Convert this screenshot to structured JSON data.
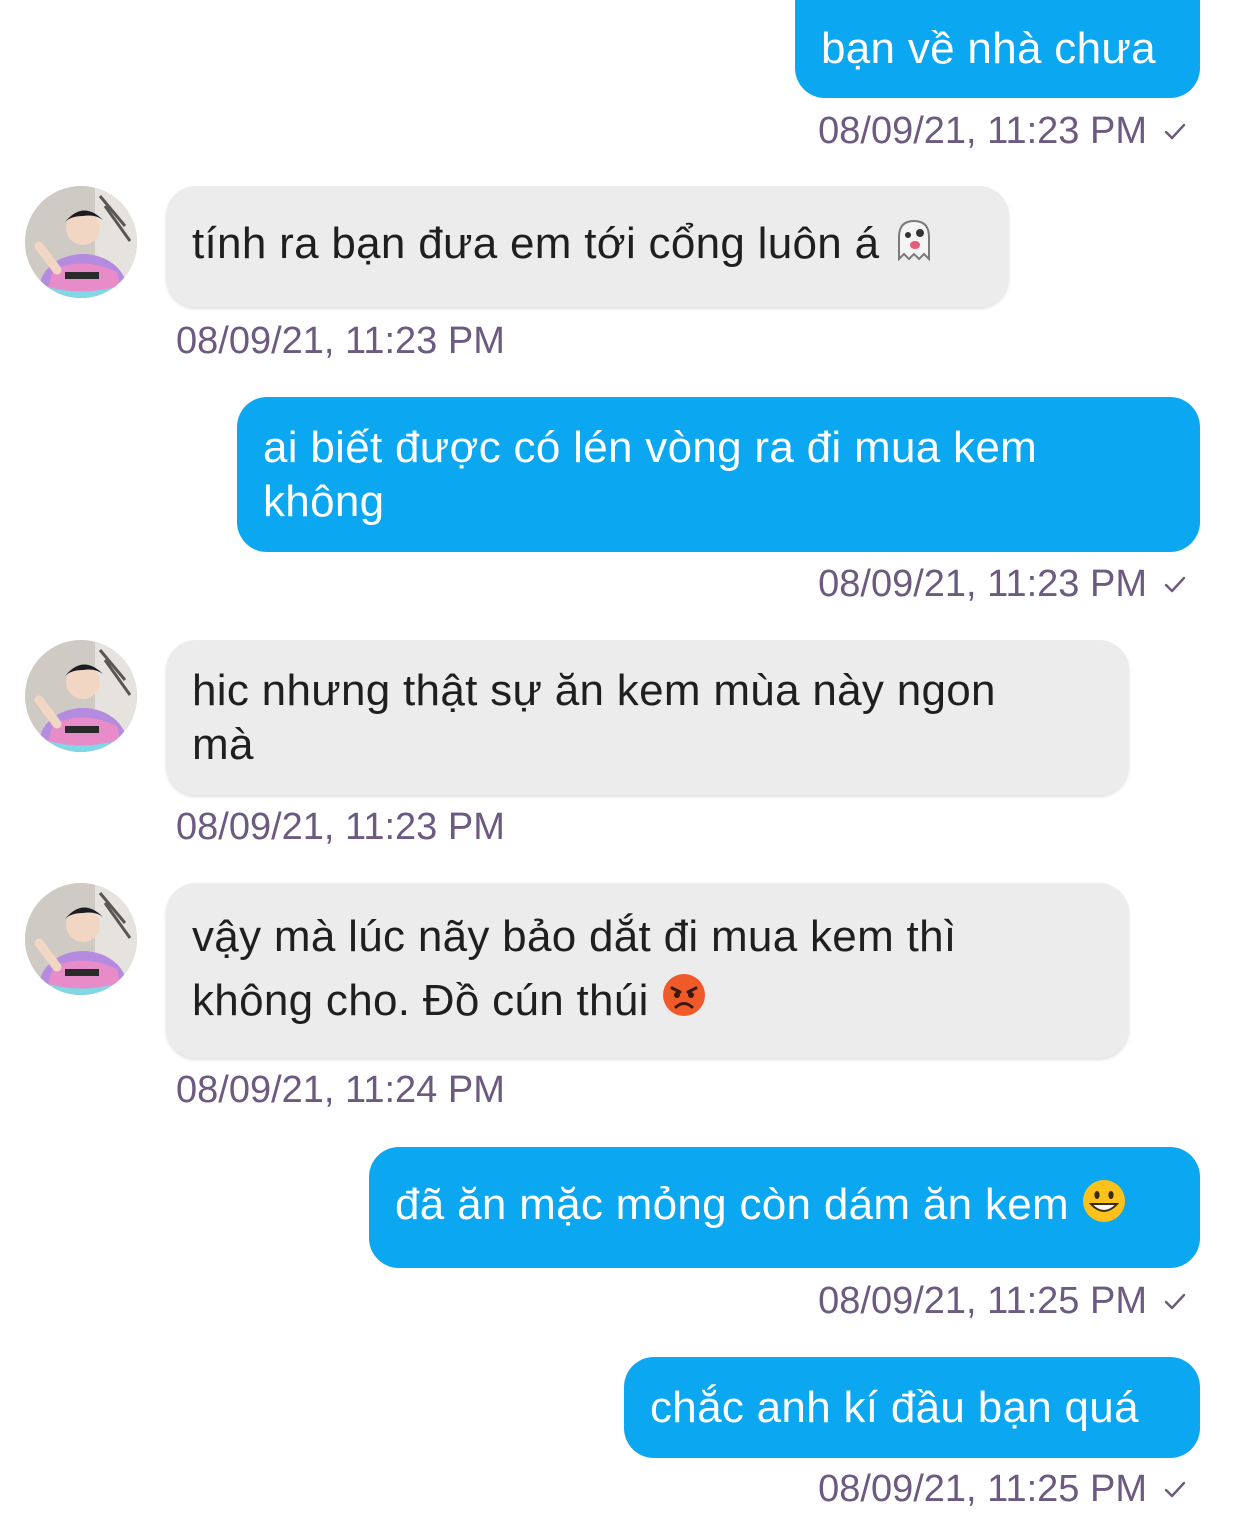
{
  "messages": [
    {
      "id": 1,
      "side": "out",
      "text": "bạn về nhà chưa",
      "time": "08/09/21, 11:23 PM"
    },
    {
      "id": 2,
      "side": "in",
      "text": "tính ra bạn đưa em tới cổng luôn á",
      "emoji": "ghost-emoji",
      "time": "08/09/21, 11:23 PM"
    },
    {
      "id": 3,
      "side": "out",
      "text": "ai biết được có lén vòng ra đi mua kem không",
      "time": "08/09/21, 11:23 PM"
    },
    {
      "id": 4,
      "side": "in",
      "text": "hic nhưng thật sự ăn kem mùa này ngon mà",
      "time": "08/09/21, 11:23 PM"
    },
    {
      "id": 5,
      "side": "in",
      "text": "vậy mà lúc nãy bảo dắt đi mua kem thì không cho. Đồ cún thúi",
      "emoji": "angry-face-emoji",
      "time": "08/09/21, 11:24 PM"
    },
    {
      "id": 6,
      "side": "out",
      "text": "đã ăn mặc mỏng còn dám ăn kem",
      "emoji": "grinning-face-emoji",
      "time": "08/09/21, 11:25 PM"
    },
    {
      "id": 7,
      "side": "out",
      "text": "chắc anh kí đầu bạn quá",
      "time": "08/09/21, 11:25 PM"
    }
  ],
  "colors": {
    "outgoing_bubble": "#0ba7f0",
    "incoming_bubble": "#ececec",
    "timestamp": "#6c5a80"
  }
}
